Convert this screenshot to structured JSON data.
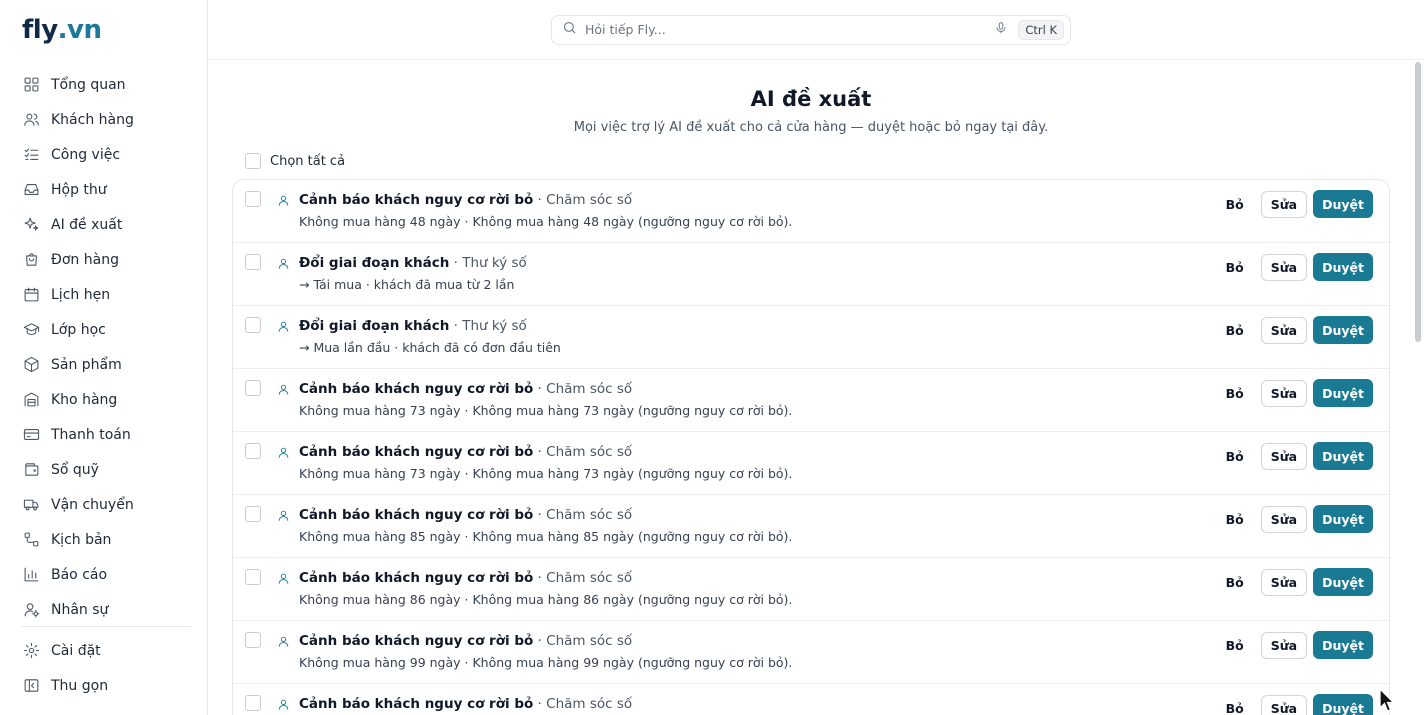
{
  "brand": {
    "name": "fly",
    "tld": ".vn"
  },
  "sidebar": {
    "items": [
      {
        "label": "Tổng quan",
        "icon": "dashboard-icon"
      },
      {
        "label": "Khách hàng",
        "icon": "users-icon"
      },
      {
        "label": "Công việc",
        "icon": "task-list-icon"
      },
      {
        "label": "Hộp thư",
        "icon": "inbox-icon"
      },
      {
        "label": "AI đề xuất",
        "icon": "sparkles-icon"
      },
      {
        "label": "Đơn hàng",
        "icon": "shopping-bag-icon"
      },
      {
        "label": "Lịch hẹn",
        "icon": "calendar-icon"
      },
      {
        "label": "Lớp học",
        "icon": "graduation-cap-icon"
      },
      {
        "label": "Sản phẩm",
        "icon": "box-icon"
      },
      {
        "label": "Kho hàng",
        "icon": "warehouse-icon"
      },
      {
        "label": "Thanh toán",
        "icon": "credit-card-icon"
      },
      {
        "label": "Sổ quỹ",
        "icon": "wallet-icon"
      },
      {
        "label": "Vận chuyển",
        "icon": "truck-icon"
      },
      {
        "label": "Kịch bản",
        "icon": "workflow-icon"
      },
      {
        "label": "Báo cáo",
        "icon": "bar-chart-icon"
      },
      {
        "label": "Nhân sự",
        "icon": "user-cog-icon"
      }
    ],
    "bottom": [
      {
        "label": "Cài đặt",
        "icon": "gear-icon"
      },
      {
        "label": "Thu gọn",
        "icon": "collapse-icon"
      }
    ]
  },
  "search": {
    "placeholder": "Hỏi tiếp Fly...",
    "shortcut": "Ctrl K"
  },
  "page": {
    "title": "AI đề xuất",
    "subtitle": "Mọi việc trợ lý AI đề xuất cho cả cửa hàng — duyệt hoặc bỏ ngay tại đây.",
    "select_all": "Chọn tất cả"
  },
  "actions": {
    "skip": "Bỏ",
    "edit": "Sửa",
    "approve": "Duyệt"
  },
  "suggestions": [
    {
      "title": "Cảnh báo khách nguy cơ rời bỏ",
      "source": " · Chăm sóc số",
      "detail": "Không mua hàng 48 ngày · Không mua hàng 48 ngày (ngưỡng nguy cơ rời bỏ)."
    },
    {
      "title": "Đổi giai đoạn khách",
      "source": " · Thư ký số",
      "detail": "→ Tái mua · khách đã mua từ 2 lần"
    },
    {
      "title": "Đổi giai đoạn khách",
      "source": " · Thư ký số",
      "detail": "→ Mua lần đầu · khách đã có đơn đầu tiên"
    },
    {
      "title": "Cảnh báo khách nguy cơ rời bỏ",
      "source": " · Chăm sóc số",
      "detail": "Không mua hàng 73 ngày · Không mua hàng 73 ngày (ngưỡng nguy cơ rời bỏ)."
    },
    {
      "title": "Cảnh báo khách nguy cơ rời bỏ",
      "source": " · Chăm sóc số",
      "detail": "Không mua hàng 73 ngày · Không mua hàng 73 ngày (ngưỡng nguy cơ rời bỏ)."
    },
    {
      "title": "Cảnh báo khách nguy cơ rời bỏ",
      "source": " · Chăm sóc số",
      "detail": "Không mua hàng 85 ngày · Không mua hàng 85 ngày (ngưỡng nguy cơ rời bỏ)."
    },
    {
      "title": "Cảnh báo khách nguy cơ rời bỏ",
      "source": " · Chăm sóc số",
      "detail": "Không mua hàng 86 ngày · Không mua hàng 86 ngày (ngưỡng nguy cơ rời bỏ)."
    },
    {
      "title": "Cảnh báo khách nguy cơ rời bỏ",
      "source": " · Chăm sóc số",
      "detail": "Không mua hàng 99 ngày · Không mua hàng 99 ngày (ngưỡng nguy cơ rời bỏ)."
    },
    {
      "title": "Cảnh báo khách nguy cơ rời bỏ",
      "source": " · Chăm sóc số",
      "detail": ""
    }
  ]
}
